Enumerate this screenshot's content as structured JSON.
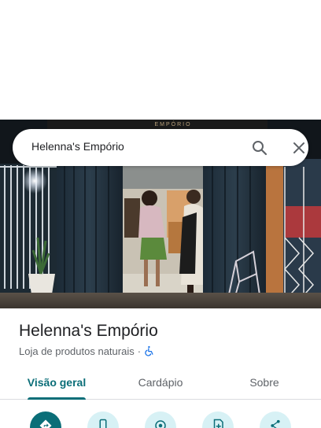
{
  "search": {
    "query": "Helenna's Empório",
    "search_icon": "search-icon",
    "close_icon": "close-icon"
  },
  "photo": {
    "sign_text": "EMPÓRIO"
  },
  "place": {
    "name": "Helenna's Empório",
    "category": "Loja de produtos naturais",
    "separator": "·",
    "accessibility_icon": "wheelchair-icon"
  },
  "tabs": [
    {
      "label": "Visão geral",
      "active": true
    },
    {
      "label": "Cardápio",
      "active": false
    },
    {
      "label": "Sobre",
      "active": false
    }
  ],
  "actions": [
    {
      "icon": "directions-icon"
    },
    {
      "icon": "phone-icon"
    },
    {
      "icon": "start-navigation-icon"
    },
    {
      "icon": "save-icon"
    },
    {
      "icon": "share-icon"
    }
  ],
  "colors": {
    "accent": "#0b6e78",
    "action_bg": "#d7f1f5",
    "secondary_text": "#5f6368"
  }
}
